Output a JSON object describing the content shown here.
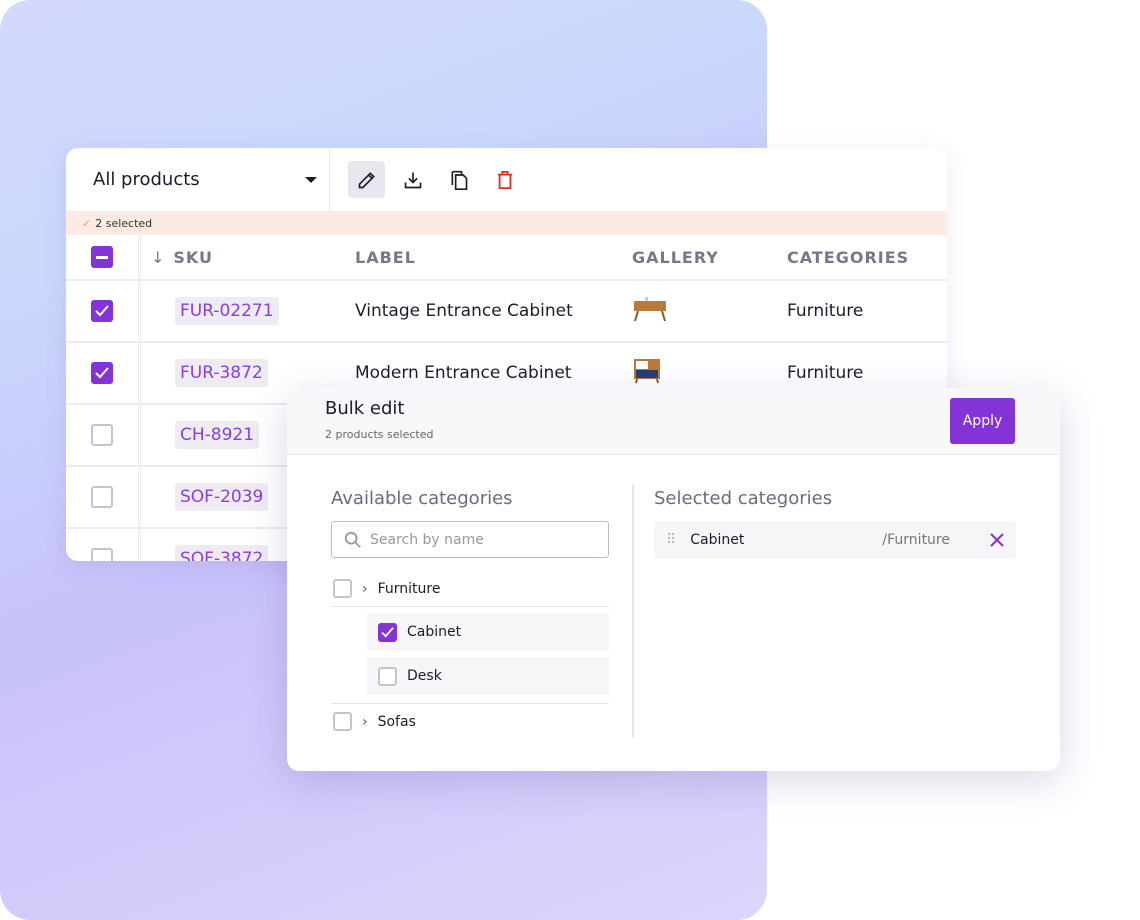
{
  "table": {
    "view_selector": "All products",
    "tools": [
      "edit-icon",
      "download-icon",
      "copy-icon",
      "delete-icon"
    ],
    "selected_text": "2 selected",
    "headers": {
      "sku": "SKU",
      "label": "LABEL",
      "gallery": "GALLERY",
      "categories": "CATEGORIES"
    },
    "rows": [
      {
        "checked": true,
        "sku": "FUR-02271",
        "label": "Vintage Entrance Cabinet",
        "category": "Furniture"
      },
      {
        "checked": true,
        "sku": "FUR-3872",
        "label": "Modern Entrance Cabinet",
        "category": "Furniture"
      },
      {
        "checked": false,
        "sku": "CH-8921",
        "label": "",
        "category": ""
      },
      {
        "checked": false,
        "sku": "SOF-2039",
        "label": "",
        "category": ""
      },
      {
        "checked": false,
        "sku": "SOF-3872",
        "label": "",
        "category": ""
      }
    ]
  },
  "bulk_edit": {
    "title": "Bulk edit",
    "subtitle": "2 products selected",
    "apply_label": "Apply",
    "available_title": "Available categories",
    "search_placeholder": "Search by name",
    "tree": {
      "furniture": "Furniture",
      "cabinet": "Cabinet",
      "desk": "Desk",
      "sofas": "Sofas"
    },
    "selected_title": "Selected categories",
    "selected": [
      {
        "name": "Cabinet",
        "path": "/Furniture"
      }
    ]
  },
  "colors": {
    "accent": "#8333d6",
    "danger": "#d9302a",
    "selection_bar": "#fcebe4"
  }
}
